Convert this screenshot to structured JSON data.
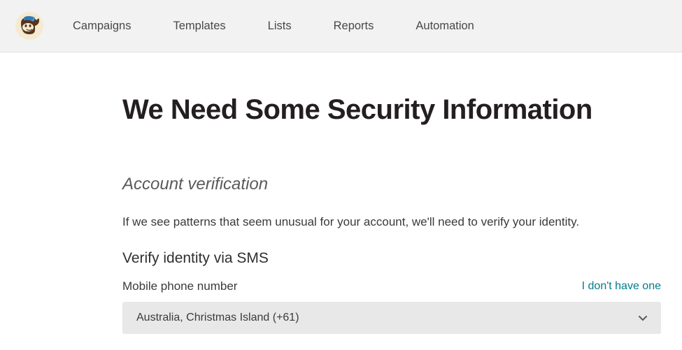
{
  "nav": {
    "items": [
      "Campaigns",
      "Templates",
      "Lists",
      "Reports",
      "Automation"
    ]
  },
  "page": {
    "heading": "We Need Some Security Information",
    "subheading": "Account verification",
    "description": "If we see patterns that seem unusual for your account, we'll need to verify your identity.",
    "method_title": "Verify identity via SMS",
    "phone_label": "Mobile phone number",
    "skip_link": "I don't have one",
    "country_selected": "Australia, Christmas Island (+61)"
  }
}
